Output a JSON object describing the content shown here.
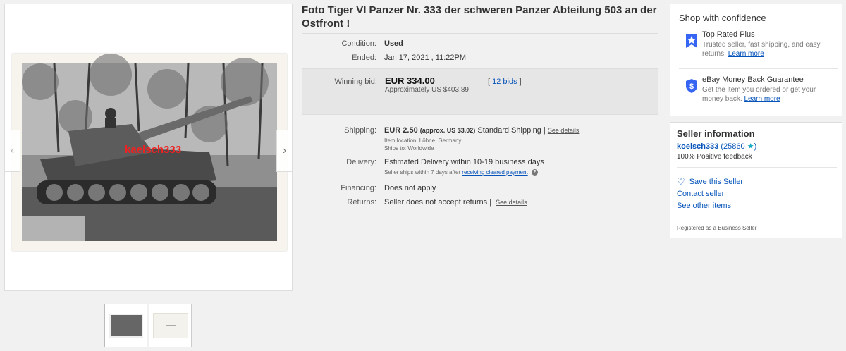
{
  "title": "Foto Tiger VI Panzer Nr. 333 der schweren Panzer Abteilung 503 an der Ostfront !",
  "gallery": {
    "watermark": "kaelsch333",
    "prev_icon": "chevron-left-icon",
    "next_icon": "chevron-right-icon",
    "prev_glyph": "‹",
    "next_glyph": "›",
    "thumbnails": [
      "thumbnail-front",
      "thumbnail-back"
    ]
  },
  "details": {
    "condition_label": "Condition:",
    "condition_value": "Used",
    "ended_label": "Ended:",
    "ended_value": "Jan 17, 2021 , 11:22PM",
    "winning_bid_label": "Winning bid:",
    "winning_bid_value": "EUR 334.00",
    "winning_bid_approx": "Approximately US $403.89",
    "bids_open": "[",
    "bids_link": "12 bids",
    "bids_close": "]",
    "shipping_label": "Shipping:",
    "shipping_value": "EUR 2.50",
    "shipping_approx": "(approx. US $3.02)",
    "shipping_method": "Standard Shipping |",
    "shipping_see_details": "See details",
    "item_location": "Item location:  Löhne, Germany",
    "ships_to": "Ships to:  Worldwide",
    "delivery_label": "Delivery:",
    "delivery_value": "Estimated Delivery within 10-19 business days",
    "delivery_note": "Seller ships within 7 days after",
    "delivery_note_link": "receiving cleared payment",
    "delivery_help_glyph": "?",
    "financing_label": "Financing:",
    "financing_value": "Does not apply",
    "returns_label": "Returns:",
    "returns_value": "Seller does not accept returns |",
    "returns_see_details": "See details"
  },
  "confidence": {
    "heading": "Shop with confidence",
    "top_rated_title": "Top Rated Plus",
    "top_rated_desc": "Trusted seller, fast shipping, and easy returns.",
    "top_rated_link": "Learn more",
    "guarantee_title": "eBay Money Back Guarantee",
    "guarantee_desc": "Get the item you ordered or get your money back.",
    "guarantee_link": "Learn more",
    "icons": [
      "top-rated-badge-icon",
      "shield-dollar-icon"
    ],
    "accent_color": "#3665f3"
  },
  "seller": {
    "heading": "Seller information",
    "username": "koelsch333",
    "score": "(25860",
    "score_close": ")",
    "star_glyph": "★",
    "feedback": "100% Positive feedback",
    "heart_glyph": "♡",
    "save_seller": "Save this Seller",
    "contact_seller": "Contact seller",
    "see_other_items": "See other items",
    "registered": "Registered as a Business Seller"
  }
}
